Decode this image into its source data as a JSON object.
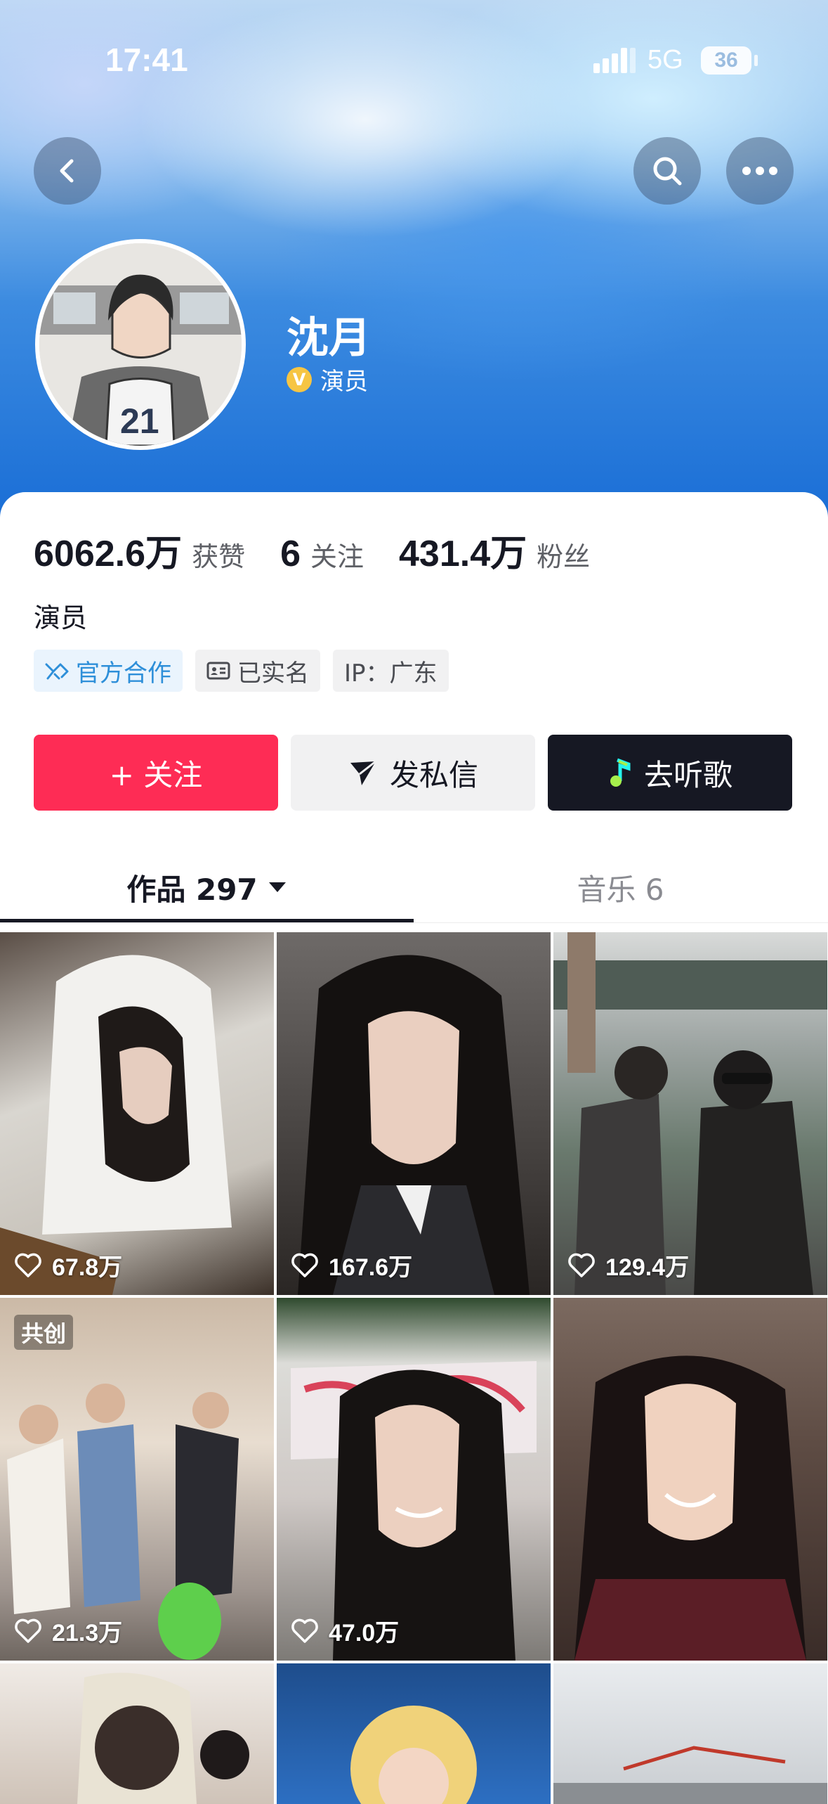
{
  "status_bar": {
    "time": "17:41",
    "network": "5G",
    "battery": "36"
  },
  "header": {
    "back_icon": "chevron-left-icon",
    "search_icon": "search-icon",
    "more_icon": "ellipsis-icon"
  },
  "profile": {
    "name": "沈月",
    "verified_label": "演员",
    "verified_color": "#f6c543",
    "stats": [
      {
        "value": "6062.6万",
        "label": "获赞"
      },
      {
        "value": "6",
        "label": "关注"
      },
      {
        "value": "431.4万",
        "label": "粉丝"
      }
    ],
    "bio": "演员",
    "tags": [
      {
        "label": "官方合作",
        "icon": "handshake-icon"
      },
      {
        "label": "已实名",
        "icon": "id-card-icon"
      },
      {
        "label": "IP：广东"
      }
    ]
  },
  "actions": {
    "follow": "+ 关注",
    "message": "发私信",
    "listen": "去听歌",
    "follow_color": "#fe2c55",
    "listen_color": "#161823"
  },
  "tabs": [
    {
      "label": "作品 297",
      "active": true
    },
    {
      "label": "音乐 6",
      "active": false
    }
  ],
  "videos": [
    {
      "likes": "67.8万"
    },
    {
      "likes": "167.6万"
    },
    {
      "likes": "129.4万"
    },
    {
      "likes": "21.3万",
      "badge": "共创"
    },
    {
      "likes": "47.0万"
    },
    {
      "likes": ""
    },
    {
      "likes": ""
    },
    {
      "likes": ""
    },
    {
      "likes": ""
    }
  ]
}
